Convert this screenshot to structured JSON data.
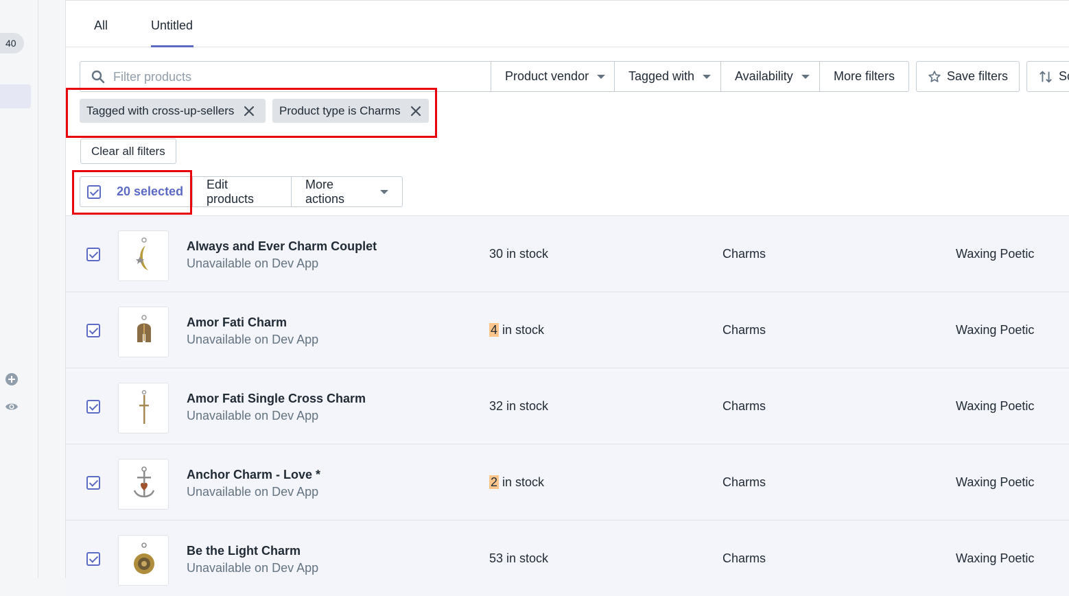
{
  "sidebar": {
    "badge_count": "40"
  },
  "tabs": [
    {
      "label": "All"
    },
    {
      "label": "Untitled",
      "active": true
    }
  ],
  "filters": {
    "search_placeholder": "Filter products",
    "buttons": [
      {
        "label": "Product vendor"
      },
      {
        "label": "Tagged with"
      },
      {
        "label": "Availability"
      },
      {
        "label": "More filters"
      }
    ],
    "save_label": "Save filters",
    "sort_label": "Sc"
  },
  "applied_filters": [
    {
      "label": "Tagged with cross-up-sellers"
    },
    {
      "label": "Product type is Charms"
    }
  ],
  "clear_all_label": "Clear all filters",
  "bulk_actions": {
    "selected_label": "20 selected",
    "edit_label": "Edit products",
    "more_label": "More actions"
  },
  "products": [
    {
      "name": "Always and Ever Charm Couplet",
      "availability": "Unavailable on Dev App",
      "stock_qty": "30",
      "stock_suffix": " in stock",
      "low_stock": false,
      "type": "Charms",
      "vendor": "Waxing Poetic"
    },
    {
      "name": "Amor Fati Charm",
      "availability": "Unavailable on Dev App",
      "stock_qty": "4",
      "stock_suffix": " in stock",
      "low_stock": true,
      "type": "Charms",
      "vendor": "Waxing Poetic"
    },
    {
      "name": "Amor Fati Single Cross Charm",
      "availability": "Unavailable on Dev App",
      "stock_qty": "32",
      "stock_suffix": " in stock",
      "low_stock": false,
      "type": "Charms",
      "vendor": "Waxing Poetic"
    },
    {
      "name": "Anchor Charm - Love *",
      "availability": "Unavailable on Dev App",
      "stock_qty": "2",
      "stock_suffix": " in stock",
      "low_stock": true,
      "type": "Charms",
      "vendor": "Waxing Poetic"
    },
    {
      "name": "Be the Light Charm",
      "availability": "Unavailable on Dev App",
      "stock_qty": "53",
      "stock_suffix": " in stock",
      "low_stock": false,
      "type": "Charms",
      "vendor": "Waxing Poetic"
    }
  ],
  "colors": {
    "accent": "#5c6ac4",
    "highlight_box": "#e8000b",
    "low_stock": "#ffc58b"
  }
}
